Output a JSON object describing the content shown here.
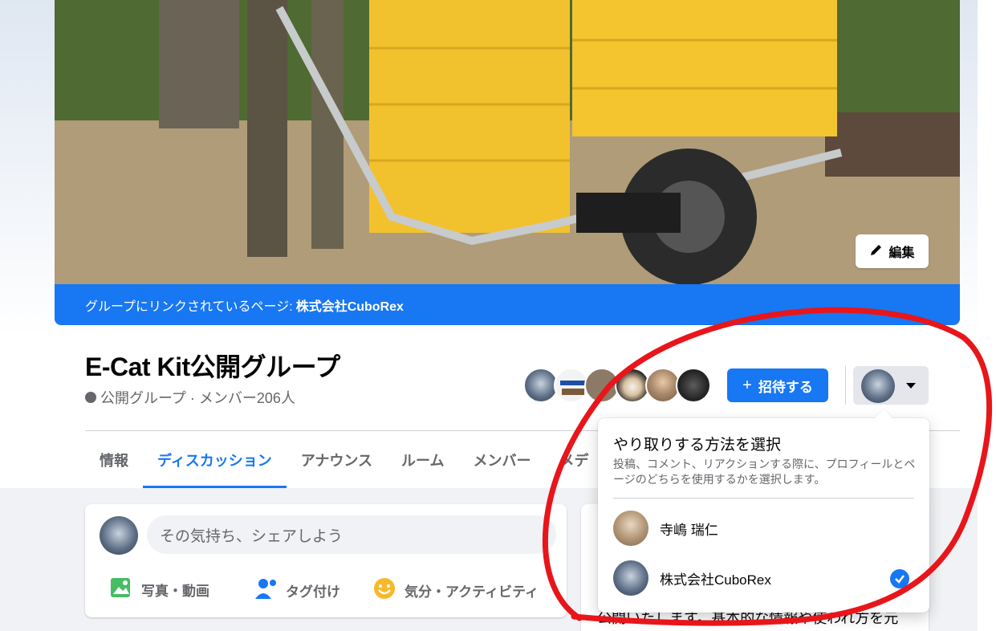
{
  "cover": {
    "edit_label": "編集",
    "linked_page_prefix": "グループにリンクされているページ: ",
    "linked_page_name": "株式会社CuboRex"
  },
  "group": {
    "name": "E-Cat Kit公開グループ",
    "privacy_and_members": "公開グループ · メンバー206人"
  },
  "header_actions": {
    "invite_label": "招待する"
  },
  "tabs": [
    {
      "label": "情報",
      "active": false
    },
    {
      "label": "ディスカッション",
      "active": true
    },
    {
      "label": "アナウンス",
      "active": false
    },
    {
      "label": "ルーム",
      "active": false
    },
    {
      "label": "メンバー",
      "active": false
    },
    {
      "label": "メデ",
      "active": false
    }
  ],
  "composer": {
    "placeholder": "その気持ち、シェアしよう",
    "actions": [
      {
        "label": "写真・動画",
        "icon": "photo-icon"
      },
      {
        "label": "タグ付け",
        "icon": "tag-people-icon"
      },
      {
        "label": "気分・アクティビティ",
        "icon": "feeling-icon"
      }
    ]
  },
  "side_text": "公開いたします。基本的な情報や使われ方を元",
  "interaction_menu": {
    "title": "やり取りする方法を選択",
    "description": "投稿、コメント、リアクションする際に、プロフィールとページのどちらを使用するかを選択します。",
    "options": [
      {
        "name": "寺嶋 瑞仁",
        "selected": false
      },
      {
        "name": "株式会社CuboRex",
        "selected": true
      }
    ]
  },
  "colors": {
    "brand_blue": "#1877f2",
    "annotation_red": "#e8151b"
  }
}
